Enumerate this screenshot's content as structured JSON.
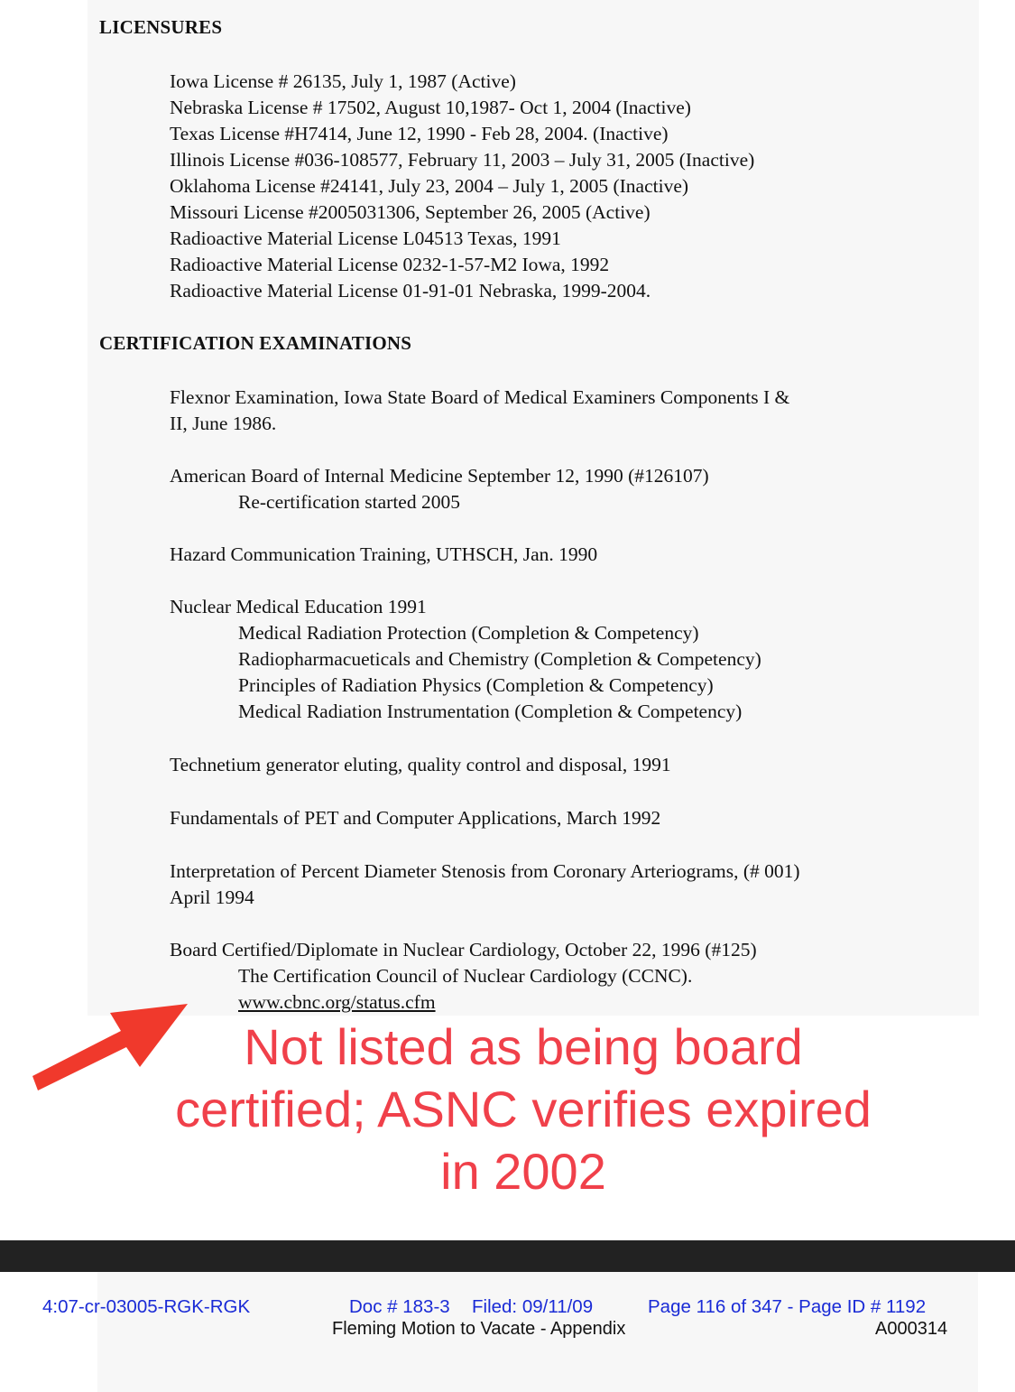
{
  "licensures": {
    "heading": "LICENSURES",
    "items": [
      "Iowa License # 26135, July 1, 1987 (Active)",
      "Nebraska License # 17502, August 10,1987- Oct 1, 2004 (Inactive)",
      "Texas License #H7414, June 12, 1990 - Feb 28, 2004. (Inactive)",
      "Illinois License #036-108577, February 11, 2003 – July 31, 2005 (Inactive)",
      "Oklahoma License #24141, July 23, 2004 – July 1, 2005 (Inactive)",
      "Missouri License #2005031306, September 26, 2005 (Active)",
      "Radioactive Material License L04513 Texas, 1991",
      "Radioactive Material License 0232-1-57-M2 Iowa, 1992",
      "Radioactive Material License 01-91-01 Nebraska, 1999-2004."
    ]
  },
  "certifications": {
    "heading": "CERTIFICATION EXAMINATIONS",
    "flexnor": [
      "Flexnor Examination, Iowa State Board of Medical Examiners Components I &",
      "II, June 1986."
    ],
    "abim": "American Board of Internal Medicine September 12, 1990 (#126107)",
    "abim_sub": "Re-certification started 2005",
    "hazard": "Hazard Communication Training, UTHSCH, Jan. 1990",
    "nuclear": "Nuclear Medical Education 1991",
    "nuclear_sub": [
      "Medical Radiation Protection (Completion & Competency)",
      "Radiopharmacueticals and Chemistry (Completion & Competency)",
      "Principles of Radiation Physics (Completion & Competency)",
      "Medical Radiation Instrumentation (Completion & Competency)"
    ],
    "technetium": "Technetium generator eluting, quality control and disposal, 1991",
    "pet": "Fundamentals of PET and Computer Applications, March 1992",
    "interpretation": [
      "Interpretation of Percent Diameter Stenosis from Coronary Arteriograms, (# 001)",
      "April 1994"
    ],
    "board": "Board Certified/Diplomate in Nuclear Cardiology, October 22, 1996 (#125)",
    "board_sub": "The Certification Council of Nuclear Cardiology (CCNC).",
    "board_link": "www.cbnc.org/status.cfm"
  },
  "annotation": {
    "lines": [
      "Not listed as being board",
      "certified; ASNC verifies expired",
      "in 2002"
    ],
    "color": "#f0404a"
  },
  "court_stamp": {
    "case": "4:07-cr-03005-RGK-RGK",
    "doc": "Doc # 183-3",
    "filed": "Filed: 09/11/09",
    "page": "Page 116 of 347 - Page ID # 1192",
    "color": "#1a2bd6"
  },
  "footer": {
    "title": "Fleming Motion to Vacate - Appendix",
    "bates": "A000314"
  }
}
